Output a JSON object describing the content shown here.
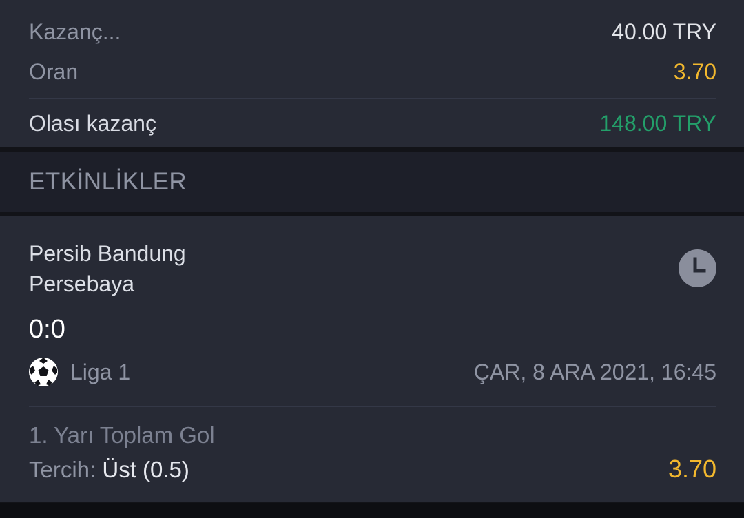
{
  "summary": {
    "stake_label": "Kazanç...",
    "stake_value": "40.00 TRY",
    "odds_label": "Oran",
    "odds_value": "3.70",
    "payout_label": "Olası kazanç",
    "payout_value": "148.00 TRY"
  },
  "section": {
    "title": "ETKİNLİKLER"
  },
  "event": {
    "home_team": "Persib Bandung",
    "away_team": "Persebaya",
    "score": "0:0",
    "status_icon": "clock-icon",
    "sport_icon": "soccer-ball-icon",
    "league": "Liga 1",
    "datetime": "ÇAR, 8 ARA 2021, 16:45",
    "market": "1. Yarı Toplam Gol",
    "pick_label": "Tercih:",
    "pick_value": "Üst (0.5)",
    "pick_odds": "3.70"
  },
  "colors": {
    "odds": "#f2b82e",
    "payout": "#23a06a",
    "panel": "#272a35",
    "header": "#1d1f29"
  }
}
